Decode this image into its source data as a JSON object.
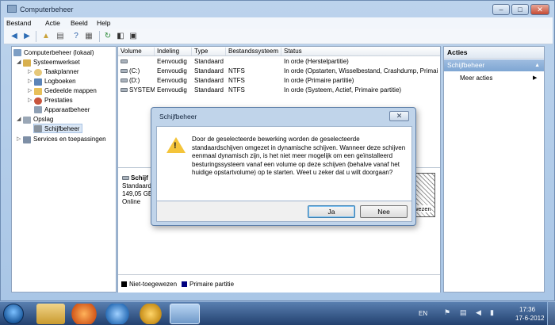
{
  "window": {
    "title": "Computerbeheer",
    "min": "–",
    "max": "□",
    "close": "✕"
  },
  "menu": [
    "Bestand",
    "Actie",
    "Beeld",
    "Help"
  ],
  "tree": [
    {
      "label": "Computerbeheer (lokaal)",
      "icon": "computer-icon"
    },
    {
      "label": "Systeemwerkset",
      "icon": "tools-icon"
    },
    {
      "label": "Taakplanner",
      "icon": "clock-icon"
    },
    {
      "label": "Logboeken",
      "icon": "log-icon"
    },
    {
      "label": "Gedeelde mappen",
      "icon": "shared-folder-icon"
    },
    {
      "label": "Prestaties",
      "icon": "performance-icon"
    },
    {
      "label": "Apparaatbeheer",
      "icon": "device-manager-icon"
    },
    {
      "label": "Opslag",
      "icon": "storage-icon"
    },
    {
      "label": "Schijfbeheer",
      "icon": "disk-icon"
    },
    {
      "label": "Services en toepassingen",
      "icon": "services-icon"
    }
  ],
  "table": {
    "headers": [
      "Volume",
      "Indeling",
      "Type",
      "Bestandssysteem",
      "Status"
    ],
    "rows": [
      [
        "",
        "Eenvoudig",
        "Standaard",
        "",
        "In orde (Herstelpartitie)"
      ],
      [
        "(C:)",
        "Eenvoudig",
        "Standaard",
        "NTFS",
        "In orde (Opstarten, Wisselbestand, Crashdump, Primai"
      ],
      [
        "(D:)",
        "Eenvoudig",
        "Standaard",
        "NTFS",
        "In orde (Primaire partitie)"
      ],
      [
        "SYSTEM",
        "Eenvoudig",
        "Standaard",
        "NTFS",
        "In orde (Systeem, Actief, Primaire partitie)"
      ]
    ]
  },
  "disk": {
    "name": "Schijf",
    "type": "Standaard",
    "size": "149,05 GB",
    "state": "Online",
    "partial": "wezen"
  },
  "legend": {
    "unallocated": "Niet-toegewezen",
    "primary": "Primaire partitie",
    "unallocated_color": "#000000",
    "primary_color": "#000080"
  },
  "actions": {
    "title": "Acties",
    "section": "Schijfbeheer",
    "more": "Meer acties"
  },
  "dialog": {
    "title": "Schijfbeheer",
    "close": "✕",
    "message": "Door de geselecteerde bewerking worden de geselecteerde standaardschijven omgezet in dynamische schijven. Wanneer deze schijven eenmaal dynamisch zijn, is het niet meer mogelijk om een geïnstalleerd besturingssysteem vanaf een volume op deze schijven (behalve vanaf het huidige opstartvolume) op te starten. Weet u zeker dat u wilt doorgaan?",
    "yes": "Ja",
    "no": "Nee"
  },
  "taskbar": {
    "lang": "EN",
    "time": "17:36",
    "date": "17-6-2012"
  }
}
